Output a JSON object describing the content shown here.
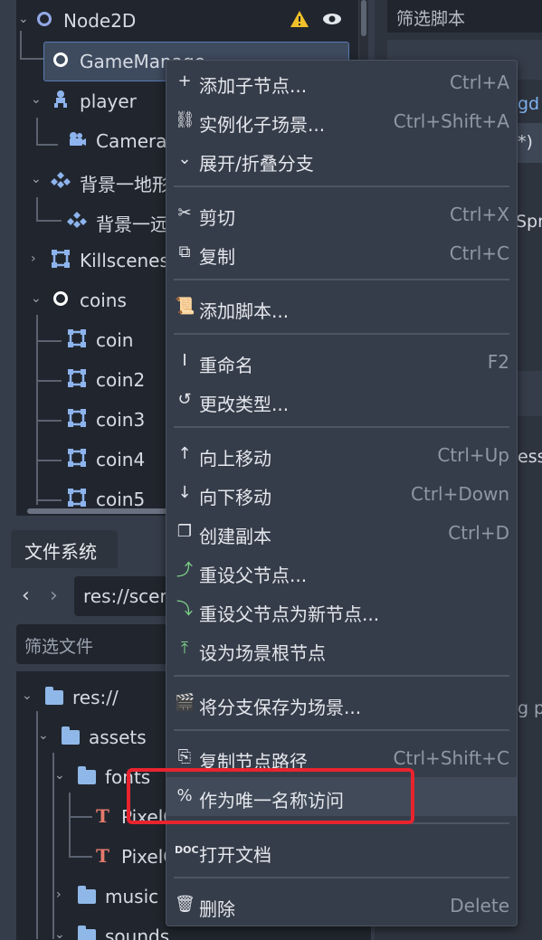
{
  "scene_tree": {
    "rows": [
      {
        "label": "Node2D",
        "icon": "node2d-circle-icon"
      },
      {
        "label": "GameManage",
        "icon": "node-circle-icon"
      },
      {
        "label": "player",
        "icon": "character-icon"
      },
      {
        "label": "Camera",
        "icon": "camera-icon"
      },
      {
        "label": "背景一地形",
        "icon": "tilemap-icon"
      },
      {
        "label": "背景一远",
        "icon": "tilemap-icon"
      },
      {
        "label": "Killscenes",
        "icon": "area2d-icon"
      },
      {
        "label": "coins",
        "icon": "node-circle-icon"
      },
      {
        "label": "coin",
        "icon": "area2d-icon"
      },
      {
        "label": "coin2",
        "icon": "area2d-icon"
      },
      {
        "label": "coin3",
        "icon": "area2d-icon"
      },
      {
        "label": "coin4",
        "icon": "area2d-icon"
      },
      {
        "label": "coin5",
        "icon": "area2d-icon"
      }
    ]
  },
  "right_panel": {
    "filter_placeholder": "筛选脚本",
    "fragments": [
      "gd",
      "*)",
      "Spr",
      "ess",
      "g",
      "p"
    ]
  },
  "filesystem": {
    "tab_label": "文件系统",
    "back_icon": "‹",
    "forward_icon": "›",
    "path": "res://scenes/",
    "filter_placeholder": "筛选文件",
    "items": [
      "res://",
      "assets",
      "fonts",
      "PixelOperator",
      "PixelOperator",
      "music",
      "sounds"
    ]
  },
  "context_menu": {
    "items": [
      {
        "label": "添加子节点...",
        "shortcut": "Ctrl+A",
        "icon": "plus-icon"
      },
      {
        "label": "实例化子场景...",
        "shortcut": "Ctrl+Shift+A",
        "icon": "link-icon"
      },
      {
        "label": "展开/折叠分支",
        "shortcut": "",
        "icon": "chevron-down-icon"
      },
      {
        "label": "剪切",
        "shortcut": "Ctrl+X",
        "icon": "scissors-icon"
      },
      {
        "label": "复制",
        "shortcut": "Ctrl+C",
        "icon": "copy-icon"
      },
      {
        "label": "添加脚本...",
        "shortcut": "",
        "icon": "script-add-icon"
      },
      {
        "label": "重命名",
        "shortcut": "F2",
        "icon": "text-cursor-icon"
      },
      {
        "label": "更改类型...",
        "shortcut": "",
        "icon": "rotate-icon"
      },
      {
        "label": "向上移动",
        "shortcut": "Ctrl+Up",
        "icon": "arrow-up-icon"
      },
      {
        "label": "向下移动",
        "shortcut": "Ctrl+Down",
        "icon": "arrow-down-icon"
      },
      {
        "label": "创建副本",
        "shortcut": "Ctrl+D",
        "icon": "duplicate-icon"
      },
      {
        "label": "重设父节点...",
        "shortcut": "",
        "icon": "reparent-icon"
      },
      {
        "label": "重设父节点为新节点...",
        "shortcut": "",
        "icon": "reparent-new-icon"
      },
      {
        "label": "设为场景根节点",
        "shortcut": "",
        "icon": "make-root-icon"
      },
      {
        "label": "将分支保存为场景...",
        "shortcut": "",
        "icon": "save-branch-icon"
      },
      {
        "label": "复制节点路径",
        "shortcut": "Ctrl+Shift+C",
        "icon": "copy-path-icon"
      },
      {
        "label": "作为唯一名称访问",
        "shortcut": "",
        "icon": "percent-icon"
      },
      {
        "label": "打开文档",
        "shortcut": "",
        "icon": "doc-icon"
      },
      {
        "label": "删除",
        "shortcut": "Delete",
        "icon": "trash-icon"
      }
    ]
  },
  "colors": {
    "accent": "#5a7bb5",
    "highlight_box": "#e8242f",
    "warning": "#f0c02a"
  }
}
